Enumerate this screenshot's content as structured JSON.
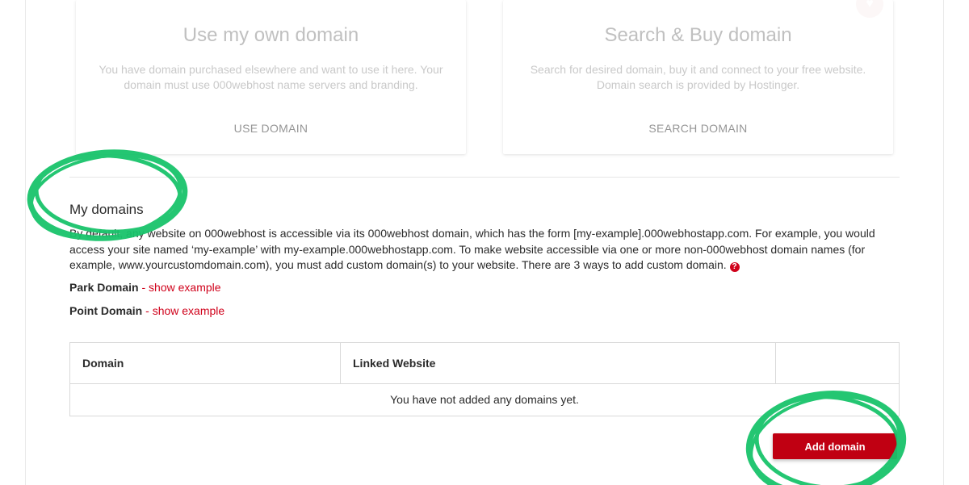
{
  "cards": {
    "own": {
      "title": "Use my own domain",
      "description": "You have domain purchased elsewhere and want to use it here. Your domain must use 000webhost name servers and branding.",
      "button": "USE DOMAIN"
    },
    "buy": {
      "title": "Search & Buy domain",
      "description": "Search for desired domain, buy it and connect to your free website. Domain search is provided by Hostinger.",
      "button": "SEARCH DOMAIN"
    }
  },
  "my_domains": {
    "title": "My domains",
    "description": "By default, any website on 000webhost is accessible via its 000webhost domain, which has the form [my-example].000webhostapp.com. For example, you would access your site named ‘my-example’ with my-example.000webhostapp.com. To make website accessible via one or more non-000webhost domain names (for example, www.yourcustomdomain.com), you must add custom domain(s) to your website. There are 3 ways to add custom domain.",
    "help_glyph": "?",
    "ways": [
      {
        "label": "Park Domain",
        "separator": " - ",
        "link": "show example"
      },
      {
        "label": "Point Domain",
        "separator": " - ",
        "link": "show example"
      }
    ]
  },
  "table": {
    "columns": [
      "Domain",
      "Linked Website",
      ""
    ],
    "empty_message": "You have not added any domains yet."
  },
  "actions": {
    "add_domain": "Add domain"
  },
  "colors": {
    "brand_red": "#c00012",
    "link_red": "#d0021b",
    "annotation_green": "#19c36b"
  }
}
